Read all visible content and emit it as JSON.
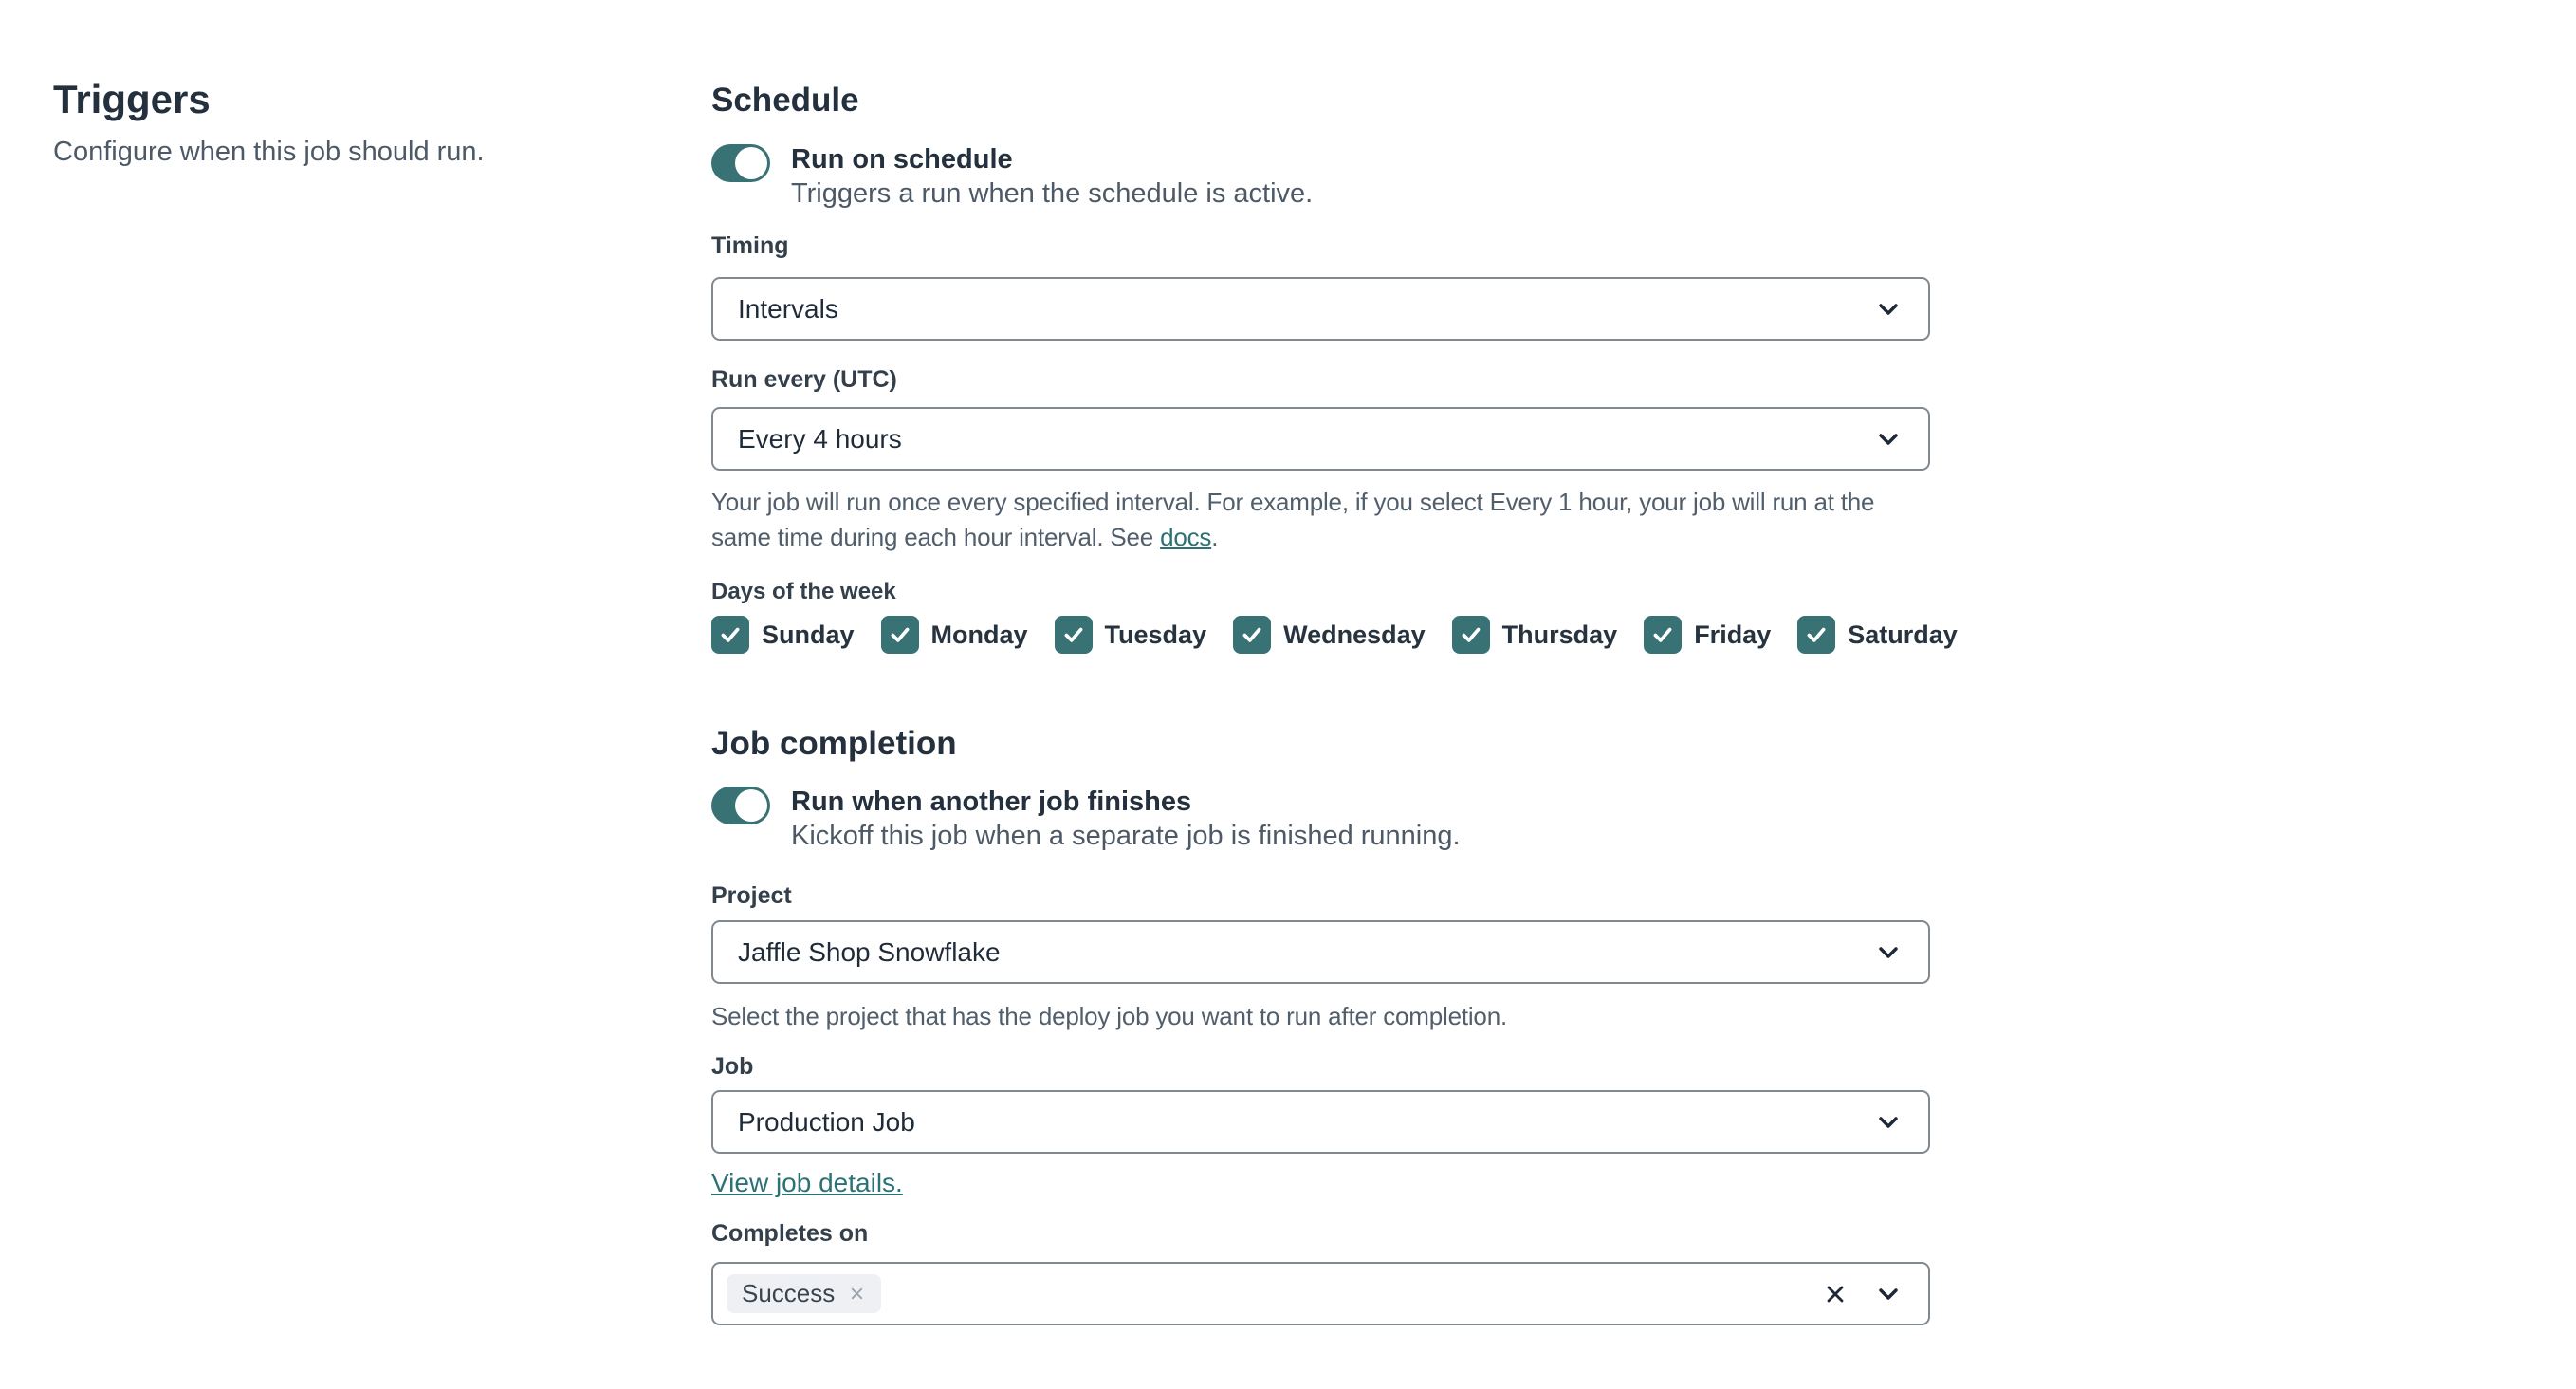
{
  "sidebar": {
    "title": "Triggers",
    "description": "Configure when this job should run."
  },
  "schedule": {
    "heading": "Schedule",
    "toggle": {
      "label": "Run on schedule",
      "description": "Triggers a run when the schedule is active.",
      "state": "on"
    },
    "timing": {
      "label": "Timing",
      "value": "Intervals"
    },
    "run_every": {
      "label": "Run every (UTC)",
      "value": "Every 4 hours",
      "help_before_link": "Your job will run once every specified interval. For example, if you select Every 1 hour, your job will run at the same time during each hour interval. See ",
      "help_link": "docs",
      "help_after_link": "."
    },
    "days": {
      "label": "Days of the week",
      "items": [
        {
          "label": "Sunday",
          "checked": true
        },
        {
          "label": "Monday",
          "checked": true
        },
        {
          "label": "Tuesday",
          "checked": true
        },
        {
          "label": "Wednesday",
          "checked": true
        },
        {
          "label": "Thursday",
          "checked": true
        },
        {
          "label": "Friday",
          "checked": true
        },
        {
          "label": "Saturday",
          "checked": true
        }
      ]
    }
  },
  "job_completion": {
    "heading": "Job completion",
    "toggle": {
      "label": "Run when another job finishes",
      "description": "Kickoff this job when a separate job is finished running.",
      "state": "on"
    },
    "project": {
      "label": "Project",
      "value": "Jaffle Shop Snowflake",
      "help": "Select the project that has the deploy job you want to run after completion."
    },
    "job": {
      "label": "Job",
      "value": "Production Job",
      "link": "View job details."
    },
    "completes_on": {
      "label": "Completes on",
      "tags": [
        {
          "label": "Success"
        }
      ]
    }
  },
  "colors": {
    "accent_teal": "#387274",
    "link_teal": "#2c7275",
    "text_dark": "#24303d",
    "text_muted": "#515e6b",
    "select_border": "#81898f",
    "tag_background": "#eef0f3"
  }
}
